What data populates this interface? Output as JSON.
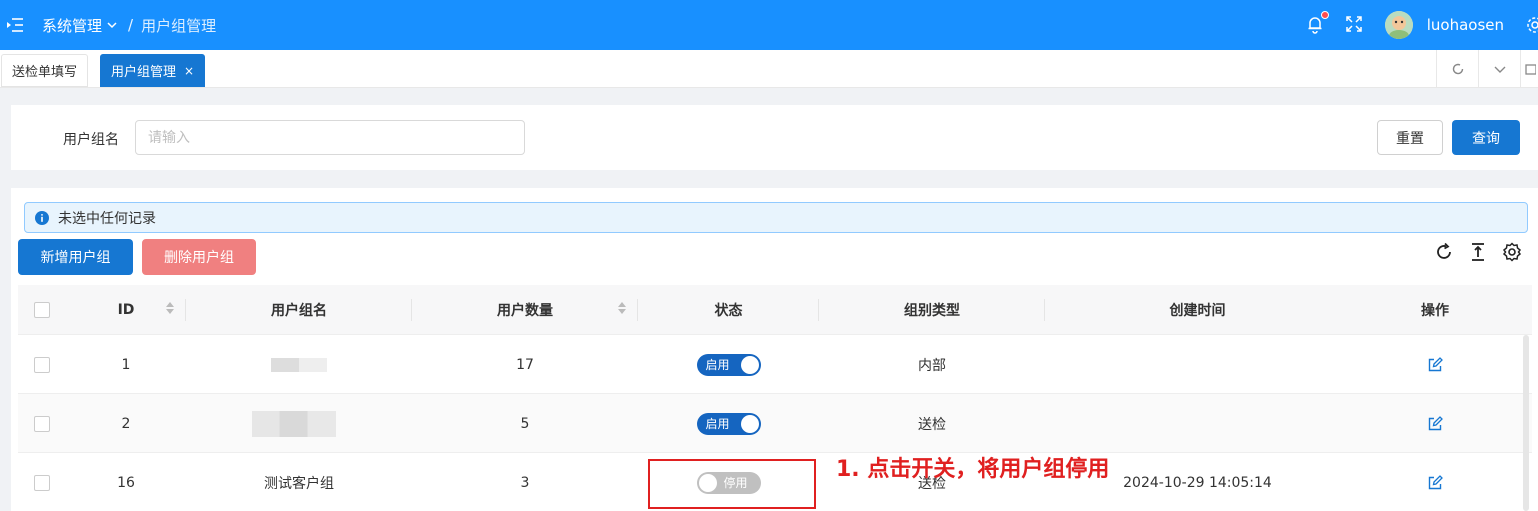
{
  "header": {
    "breadcrumb_root": "系统管理",
    "breadcrumb_sep": "/",
    "breadcrumb_current": "用户组管理",
    "username": "luohaosen",
    "icons": [
      "menu-fold-icon",
      "chevron-down-icon",
      "bell-icon",
      "fullscreen-icon",
      "avatar",
      "gear-icon"
    ],
    "accent": "#1890ff"
  },
  "tabs": [
    {
      "label": "送检单填写",
      "active": false
    },
    {
      "label": "用户组管理",
      "active": true,
      "close": "×"
    }
  ],
  "search": {
    "label": "用户组名",
    "placeholder": "请输入",
    "reset_label": "重置",
    "query_label": "查询"
  },
  "table_area": {
    "alert_text": "未选中任何记录",
    "add_label": "新增用户组",
    "delete_label": "删除用户组",
    "tools": [
      "refresh-icon",
      "column-height-icon",
      "settings-icon"
    ]
  },
  "table": {
    "columns": [
      "ID",
      "用户组名",
      "用户数量",
      "状态",
      "组别类型",
      "创建时间",
      "操作"
    ],
    "rows": [
      {
        "id": "1",
        "name": "",
        "count": "17",
        "status": "启用",
        "on": true,
        "type": "内部",
        "created": ""
      },
      {
        "id": "2",
        "name": "",
        "count": "5",
        "status": "启用",
        "on": true,
        "type": "送检",
        "created": ""
      },
      {
        "id": "16",
        "name": "测试客户组",
        "count": "3",
        "status": "停用",
        "on": false,
        "type": "送检",
        "created": "2024-10-29 14:05:14"
      }
    ]
  },
  "annotation": {
    "text": "1. 点击开关，将用户组停用",
    "color": "#e02020"
  }
}
